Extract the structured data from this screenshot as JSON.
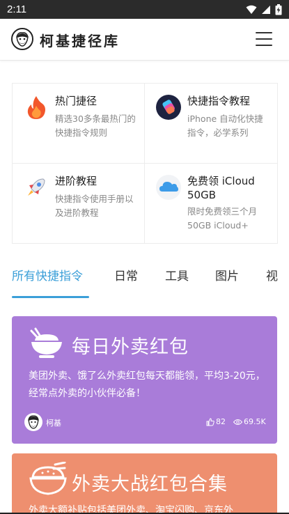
{
  "status_bar": {
    "time": "2:11",
    "icons": [
      "wifi-icon",
      "signal-icon",
      "battery-icon"
    ]
  },
  "app_bar": {
    "title": "柯基捷径库",
    "logo": "corgi-logo",
    "menu_icon": "hamburger-menu-icon"
  },
  "categories": [
    {
      "title": "热门捷径",
      "desc": "精选30多条最热门的快捷指令规则",
      "icon": "fire-icon"
    },
    {
      "title": "快捷指令教程",
      "desc": "iPhone 自动化快捷指令，必学系列",
      "icon": "shortcuts-app-icon"
    },
    {
      "title": "进阶教程",
      "desc": "快捷指令使用手册以及进阶教程",
      "icon": "rocket-icon"
    },
    {
      "title": "免费领 iCloud 50GB",
      "desc": "限时免费领三个月 50GB iCloud+",
      "icon": "icloud-icon"
    }
  ],
  "tabs": [
    {
      "label": "所有快捷指令",
      "active": true
    },
    {
      "label": "日常",
      "active": false
    },
    {
      "label": "工具",
      "active": false
    },
    {
      "label": "图片",
      "active": false
    },
    {
      "label": "视",
      "active": false
    }
  ],
  "cards": [
    {
      "title": "每日外卖红包",
      "desc": "美团外卖、饿了么外卖红包每天都能领，平均3-20元，经常点外卖的小伙伴必备！",
      "author": "柯基",
      "likes": "82",
      "views": "69.5K",
      "color": "#a97cd9",
      "icon": "food-bowl-icon"
    },
    {
      "title": "外卖大战红包合集",
      "desc": "外卖大额补贴包括美团外卖、淘宝闪购、京东外",
      "color": "#ee8f6f",
      "icon": "food-bowl-icon"
    }
  ],
  "colors": {
    "accent": "#3b9fd8",
    "status_bar": "#2b2b2b"
  }
}
